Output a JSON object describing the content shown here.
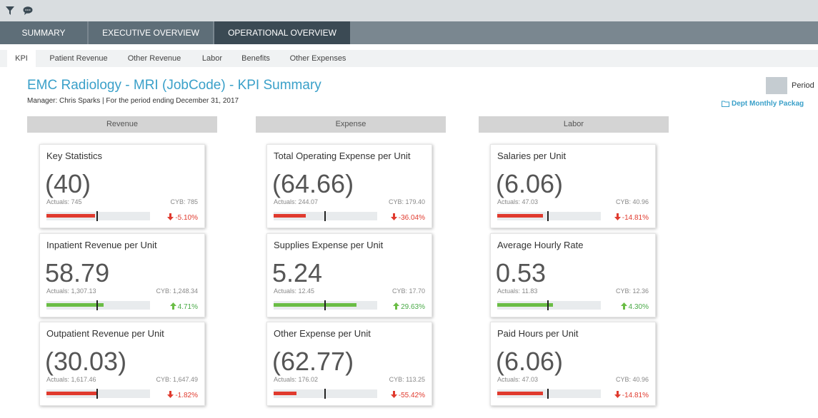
{
  "toolbar": {
    "icons": [
      "filter-icon",
      "comment-icon"
    ]
  },
  "primary_tabs": [
    {
      "label": "SUMMARY",
      "active": false
    },
    {
      "label": "EXECUTIVE OVERVIEW",
      "active": false
    },
    {
      "label": "OPERATIONAL OVERVIEW",
      "active": true
    }
  ],
  "secondary_tabs": [
    {
      "label": "KPI",
      "active": true
    },
    {
      "label": "Patient Revenue",
      "active": false
    },
    {
      "label": "Other Revenue",
      "active": false
    },
    {
      "label": "Labor",
      "active": false
    },
    {
      "label": "Benefits",
      "active": false
    },
    {
      "label": "Other Expenses",
      "active": false
    }
  ],
  "page": {
    "title": "EMC Radiology - MRI (JobCode) - KPI Summary",
    "subtitle": "Manager: Chris Sparks | For the period ending December 31, 2017",
    "period_toggle": "Period",
    "dept_link": "Dept Monthly Packag"
  },
  "colors": {
    "accent": "#3aa0c9",
    "negative": "#e03a2e",
    "positive": "#6abd45"
  },
  "columns": [
    {
      "header": "Revenue",
      "cards": [
        {
          "title": "Key Statistics",
          "value": "(40)",
          "actuals": "Actuals: 745",
          "cyb": "CYB: 785",
          "variance": "-5.10%",
          "direction": "down",
          "fill": 0.47
        },
        {
          "title": "Inpatient Revenue per Unit",
          "value": "58.79",
          "actuals": "Actuals: 1,307.13",
          "cyb": "CYB: 1,248.34",
          "variance": "4.71%",
          "direction": "up",
          "fill": 0.55
        },
        {
          "title": "Outpatient Revenue per Unit",
          "value": "(30.03)",
          "actuals": "Actuals: 1,617.46",
          "cyb": "CYB: 1,647.49",
          "variance": "-1.82%",
          "direction": "down",
          "fill": 0.49
        }
      ]
    },
    {
      "header": "Expense",
      "cards": [
        {
          "title": "Total Operating Expense per Unit",
          "value": "(64.66)",
          "actuals": "Actuals: 244.07",
          "cyb": "CYB: 179.40",
          "variance": "-36.04%",
          "direction": "down",
          "fill": 0.31
        },
        {
          "title": "Supplies Expense per Unit",
          "value": "5.24",
          "actuals": "Actuals: 12.45",
          "cyb": "CYB: 17.70",
          "variance": "29.63%",
          "direction": "up",
          "fill": 0.8
        },
        {
          "title": "Other Expense per Unit",
          "value": "(62.77)",
          "actuals": "Actuals: 176.02",
          "cyb": "CYB: 113.25",
          "variance": "-55.42%",
          "direction": "down",
          "fill": 0.22
        }
      ]
    },
    {
      "header": "Labor",
      "cards": [
        {
          "title": "Salaries per Unit",
          "value": "(6.06)",
          "actuals": "Actuals: 47.03",
          "cyb": "CYB: 40.96",
          "variance": "-14.81%",
          "direction": "down",
          "fill": 0.44
        },
        {
          "title": "Average Hourly Rate",
          "value": "0.53",
          "actuals": "Actuals: 11.83",
          "cyb": "CYB: 12.36",
          "variance": "4.30%",
          "direction": "up",
          "fill": 0.54
        },
        {
          "title": "Paid Hours per Unit",
          "value": "(6.06)",
          "actuals": "Actuals: 47.03",
          "cyb": "CYB: 40.96",
          "variance": "-14.81%",
          "direction": "down",
          "fill": 0.44
        }
      ]
    }
  ]
}
